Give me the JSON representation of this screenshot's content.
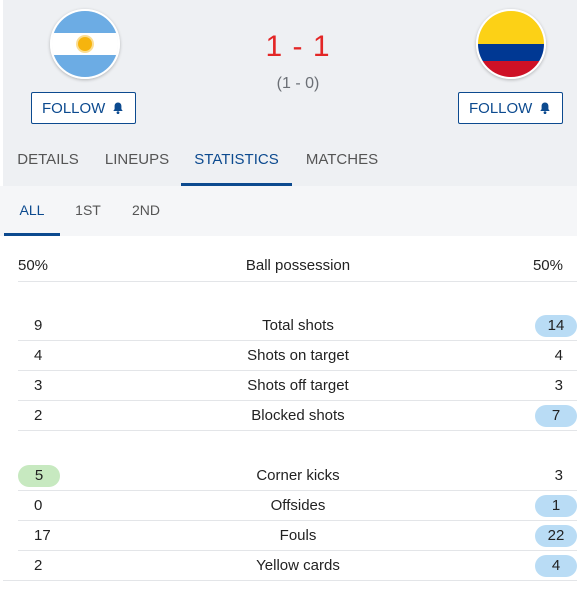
{
  "match": {
    "home_team": {
      "flag": "argentina-flag",
      "follow_label": "FOLLOW"
    },
    "away_team": {
      "flag": "colombia-flag",
      "follow_label": "FOLLOW"
    },
    "score": "1 - 1",
    "aggregate": "(1 - 0)"
  },
  "tabs": [
    "DETAILS",
    "LINEUPS",
    "STATISTICS",
    "MATCHES"
  ],
  "active_tab": "STATISTICS",
  "subtabs": [
    "ALL",
    "1ST",
    "2ND"
  ],
  "active_subtab": "ALL",
  "colors": {
    "accent": "#0c4a8f",
    "score": "#e32626",
    "home_highlight": "#c7e9c0",
    "away_highlight": "#b9dcf5"
  },
  "stats": [
    {
      "name": "Ball possession",
      "home": "50%",
      "away": "50%",
      "highlight": "none"
    },
    {
      "name": "Total shots",
      "home": "9",
      "away": "14",
      "highlight": "away"
    },
    {
      "name": "Shots on target",
      "home": "4",
      "away": "4",
      "highlight": "none"
    },
    {
      "name": "Shots off target",
      "home": "3",
      "away": "3",
      "highlight": "none"
    },
    {
      "name": "Blocked shots",
      "home": "2",
      "away": "7",
      "highlight": "away"
    },
    {
      "name": "Corner kicks",
      "home": "5",
      "away": "3",
      "highlight": "home"
    },
    {
      "name": "Offsides",
      "home": "0",
      "away": "1",
      "highlight": "away"
    },
    {
      "name": "Fouls",
      "home": "17",
      "away": "22",
      "highlight": "away"
    },
    {
      "name": "Yellow cards",
      "home": "2",
      "away": "4",
      "highlight": "away"
    }
  ]
}
